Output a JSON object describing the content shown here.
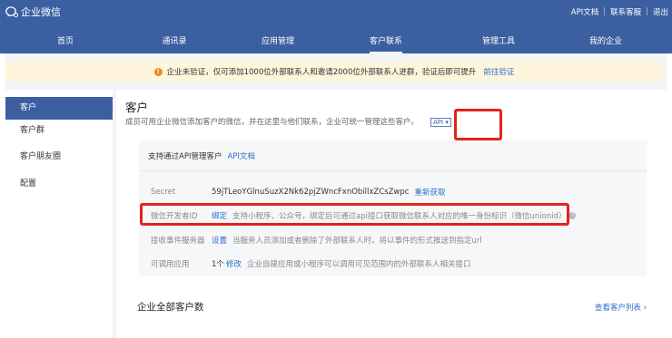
{
  "header": {
    "brand": "企业微信",
    "links": [
      "API文档",
      "联系客服",
      "退出"
    ]
  },
  "nav": {
    "items": [
      "首页",
      "通讯录",
      "应用管理",
      "客户联系",
      "管理工具",
      "我的企业"
    ],
    "active": "客户联系"
  },
  "notice": {
    "text": "企业未验证，仅可添加1000位外部联系人和邀请2000位外部联系人进群，验证后即可提升",
    "link": "前往验证"
  },
  "sidebar": {
    "items": [
      {
        "label": "客户",
        "active": true
      },
      {
        "label": "客户群",
        "active": false
      },
      {
        "label": "客户朋友圈",
        "active": false
      },
      {
        "label": "配置",
        "active": false
      }
    ]
  },
  "main": {
    "title": "客户",
    "description": "成员可用企业微信添加客户的微信，并在这里与他们联系，企业可统一管理这些客户。",
    "api_tag": "API ▾",
    "panel": {
      "heading": "支持通过API管理客户",
      "heading_link": "API文档",
      "rows": {
        "secret": {
          "label": "Secret",
          "value": "59jTLeoYGlnuSuzX2Nk62pjZWncFxnObillxZCsZwpc",
          "action": "重新获取"
        },
        "dev_id": {
          "label": "微信开发者ID",
          "action": "绑定",
          "tip": "支持小程序、公众号，绑定后可通过api接口获取微信联系人对应的唯一身份标识（微信unionid）"
        },
        "event": {
          "label": "接收事件服务器",
          "action": "设置",
          "tip": "当服务人员添加或者删除了外部联系人时，将以事件的形式推送到指定url"
        },
        "apps": {
          "label": "可调用应用",
          "count": "1个",
          "action": "修改",
          "tip": "企业自建应用或小程序可以调用可见范围内的外部联系人相关接口"
        }
      }
    },
    "all_customers_title": "企业全部客户数",
    "view_list": "查看客户列表 ›"
  },
  "colors": {
    "header_bg": "#3b5fa0",
    "link": "#2a6fcb",
    "highlight_box": "#e2231a",
    "notice_bg": "#fff4dc"
  }
}
